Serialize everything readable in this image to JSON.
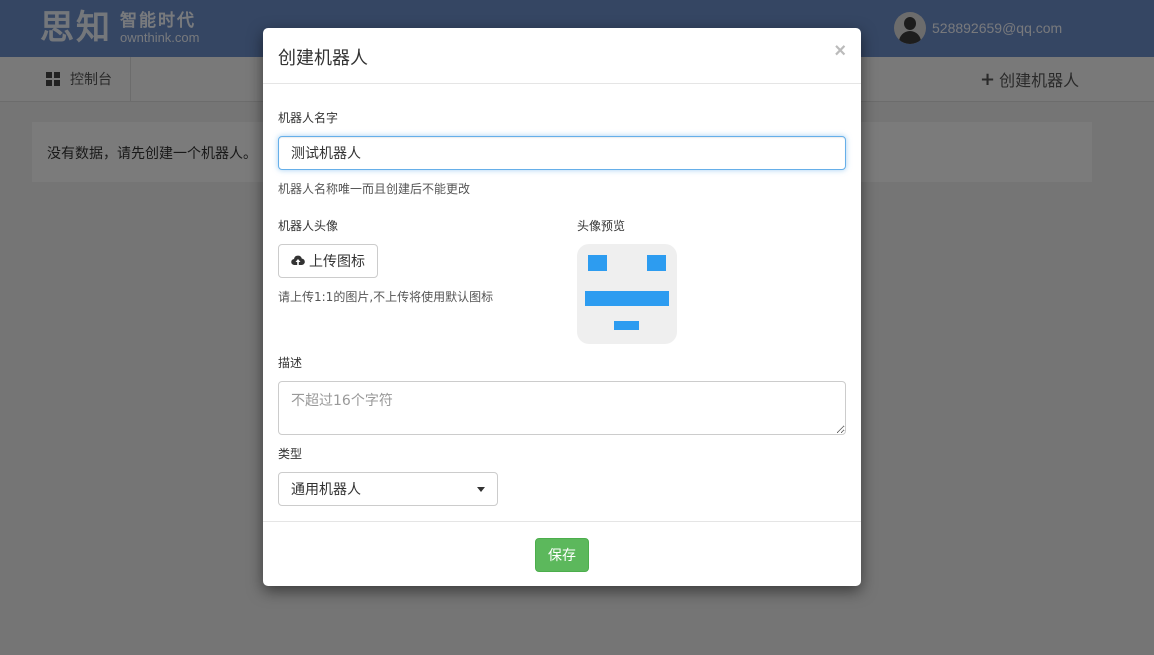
{
  "brand": {
    "mark": "思知",
    "slogan": "智能时代",
    "domain": "ownthink.com"
  },
  "user": {
    "email": "528892659@qq.com",
    "avatar_icon": "user-avatar-icon"
  },
  "nav": {
    "dashboard_label": "控制台",
    "dashboard_icon": "grid-icon",
    "create_label": "创建机器人"
  },
  "main": {
    "empty_message": "没有数据，请先创建一个机器人。"
  },
  "modal": {
    "title": "创建机器人",
    "close_label": "×",
    "name": {
      "label": "机器人名字",
      "value": "测试机器人",
      "help": "机器人名称唯一而且创建后不能更改"
    },
    "avatar": {
      "label": "机器人头像",
      "upload_label": "上传图标",
      "upload_icon": "cloud-upload-icon",
      "help": "请上传1:1的图片,不上传将使用默认图标",
      "preview_label": "头像预览",
      "preview_color": "#2d9cf0"
    },
    "description": {
      "label": "描述",
      "placeholder": "不超过16个字符"
    },
    "type": {
      "label": "类型",
      "selected": "通用机器人"
    },
    "save_label": "保存"
  },
  "colors": {
    "header": "#6b8cc7",
    "save_button": "#5cb85c",
    "focus_border": "#66afe9"
  }
}
